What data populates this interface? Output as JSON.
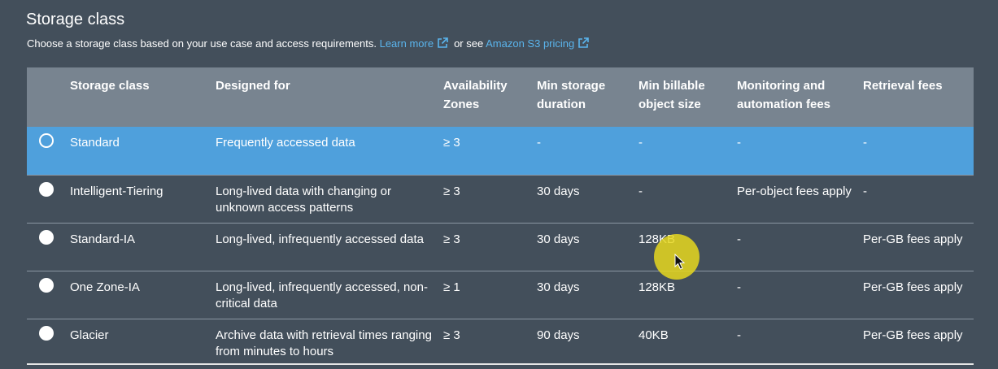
{
  "section": {
    "title": "Storage class",
    "description": "Choose a storage class based on your use case and access requirements.",
    "learn_more": "Learn more",
    "or_see": "or see",
    "pricing_link": "Amazon S3 pricing"
  },
  "table": {
    "headers": {
      "storage_class": "Storage class",
      "designed_for": "Designed for",
      "az_line1": "Availability",
      "az_line2": "Zones",
      "min_storage_line1": "Min storage",
      "min_storage_line2": "duration",
      "min_billable_line1": "Min billable",
      "min_billable_line2": "object size",
      "monitoring_line1": "Monitoring and",
      "monitoring_line2": "automation fees",
      "retrieval": "Retrieval fees"
    },
    "rows": [
      {
        "selected": true,
        "storage_class": "Standard",
        "designed_for": "Frequently accessed data",
        "az": "≥ 3",
        "min_storage": "-",
        "min_billable": "-",
        "monitoring": "-",
        "retrieval": "-"
      },
      {
        "selected": false,
        "storage_class": "Intelligent-Tiering",
        "designed_for": "Long-lived data with changing or unknown access patterns",
        "az": "≥ 3",
        "min_storage": "30 days",
        "min_billable": "-",
        "monitoring": "Per-object fees apply",
        "retrieval": "-"
      },
      {
        "selected": false,
        "storage_class": "Standard-IA",
        "designed_for": "Long-lived, infrequently accessed data",
        "az": "≥ 3",
        "min_storage": "30 days",
        "min_billable": "128KB",
        "monitoring": "-",
        "retrieval": "Per-GB fees apply"
      },
      {
        "selected": false,
        "storage_class": "One Zone-IA",
        "designed_for": "Long-lived, infrequently accessed, non-critical data",
        "az": "≥ 1",
        "min_storage": "30 days",
        "min_billable": "128KB",
        "monitoring": "-",
        "retrieval": "Per-GB fees apply"
      },
      {
        "selected": false,
        "storage_class": "Glacier",
        "designed_for": "Archive data with retrieval times ranging from minutes to hours",
        "az": "≥ 3",
        "min_storage": "90 days",
        "min_billable": "40KB",
        "monitoring": "-",
        "retrieval": "Per-GB fees apply"
      }
    ]
  },
  "colors": {
    "background": "#434f5b",
    "header_bg": "#788490",
    "selected_row": "#4fa0dc",
    "link": "#5ab4ec",
    "cursor_highlight": "#e6d71e"
  },
  "icons": {
    "external_link": "external-link-icon",
    "radio": "radio-button",
    "cursor": "mouse-pointer-icon"
  }
}
